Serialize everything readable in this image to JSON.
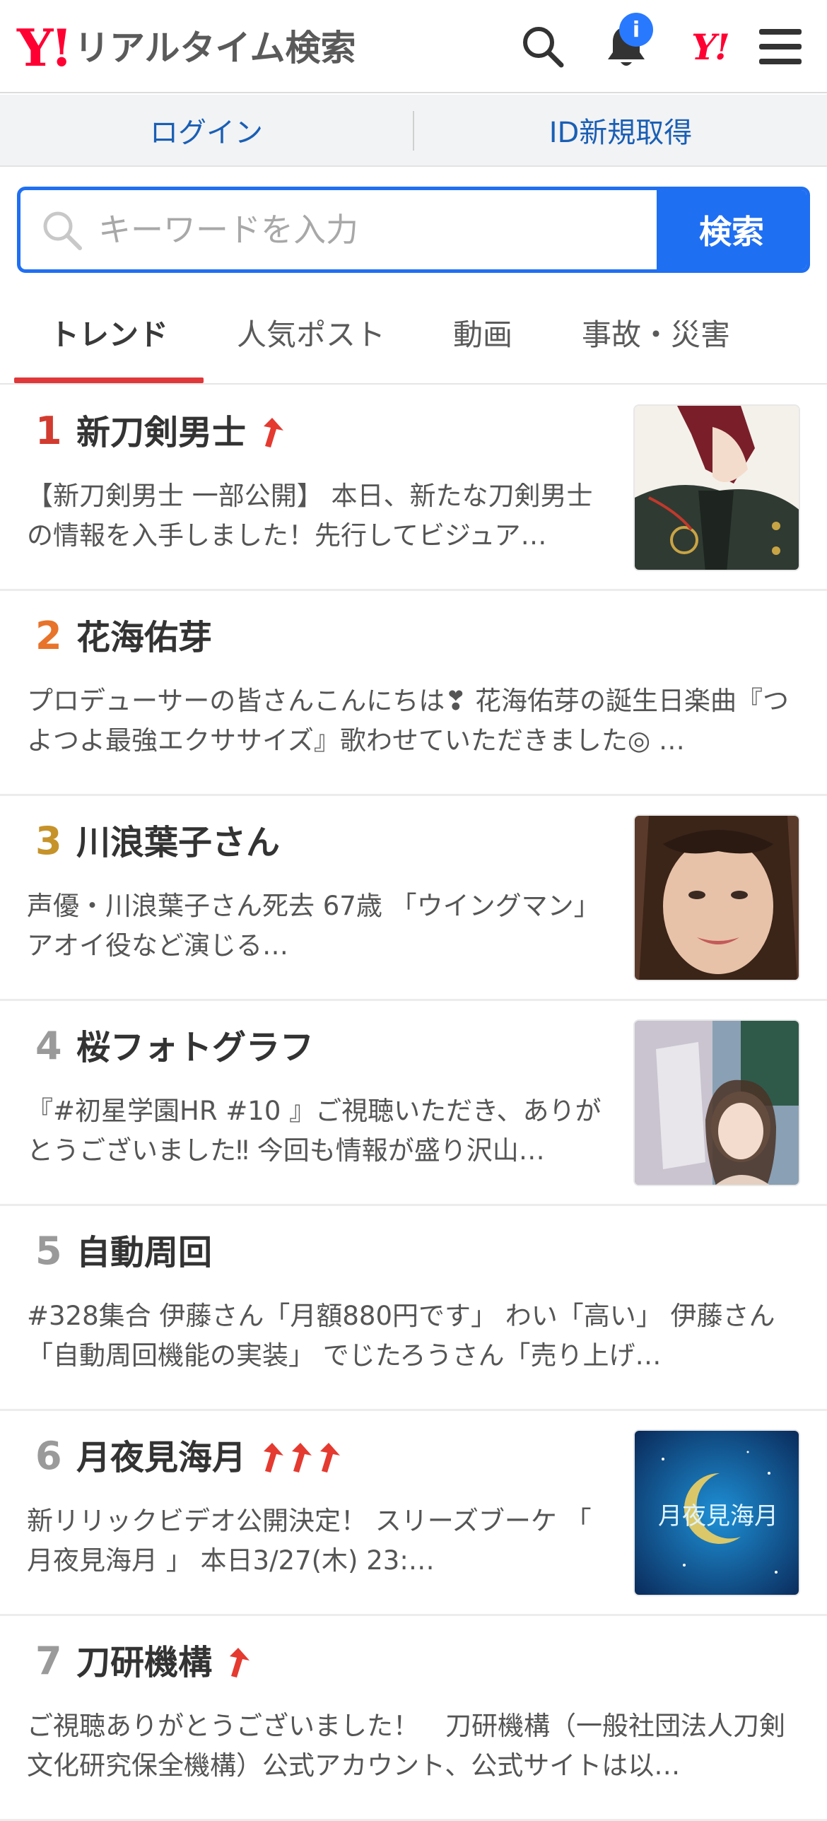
{
  "header": {
    "logo": "Y!",
    "title": "リアルタイム検索",
    "notification_badge": "i",
    "yj_logo": "Y!"
  },
  "loginbar": {
    "login": "ログイン",
    "signup": "ID新規取得"
  },
  "search": {
    "placeholder": "キーワードを入力",
    "button": "検索"
  },
  "tabs": [
    {
      "label": "トレンド",
      "active": true
    },
    {
      "label": "人気ポスト",
      "active": false
    },
    {
      "label": "動画",
      "active": false
    },
    {
      "label": "事故・災害",
      "active": false
    }
  ],
  "trends": [
    {
      "rank": "1",
      "title": "新刀剣男士",
      "arrows": 1,
      "has_thumb": true,
      "desc": "【新刀剣男士 一部公開】 本日、新たな刀剣男士の情報を入手しました！先行してビジュア…"
    },
    {
      "rank": "2",
      "title": "花海佑芽",
      "arrows": 0,
      "has_thumb": false,
      "desc": "プロデューサーの皆さんこんにちは❣ 花海佑芽の誕生日楽曲『つよつよ最強エクササイズ』歌わせていただきました◎ …"
    },
    {
      "rank": "3",
      "title": "川浪葉子さん",
      "arrows": 0,
      "has_thumb": true,
      "desc": "声優・川浪葉子さん死去 67歳 「ウイングマン」アオイ役など演じる…"
    },
    {
      "rank": "4",
      "title": "桜フォトグラフ",
      "arrows": 0,
      "has_thumb": true,
      "desc": "『#初星学園HR #10 』ご視聴いただき、ありがとうございました‼ 今回も情報が盛り沢山…"
    },
    {
      "rank": "5",
      "title": "自動周回",
      "arrows": 0,
      "has_thumb": false,
      "desc": "#328集合 伊藤さん「月額880円です」 わい「高い」 伊藤さん「自動周回機能の実装」 でじたろうさん「売り上げ…"
    },
    {
      "rank": "6",
      "title": "月夜見海月",
      "arrows": 3,
      "has_thumb": true,
      "desc": "新リリックビデオ公開決定！  スリーズブーケ  「 月夜見海月 」 本日3/27(木) 23:…"
    },
    {
      "rank": "7",
      "title": "刀研機構",
      "arrows": 1,
      "has_thumb": false,
      "desc": "ご視聴ありがとうございました！　刀研機構（一般社団法人刀剣文化研究保全機構）公式アカウント、公式サイトは以…"
    }
  ],
  "thumb_6_text": "月夜見海月",
  "colors": {
    "accent_blue": "#1f6ff2",
    "brand_red": "#ff0033",
    "tab_underline": "#e0383a",
    "rank1": "#d23b2f",
    "rank2": "#e8732a",
    "rank3": "#c6932a",
    "rank_other": "#9a9a9a"
  }
}
